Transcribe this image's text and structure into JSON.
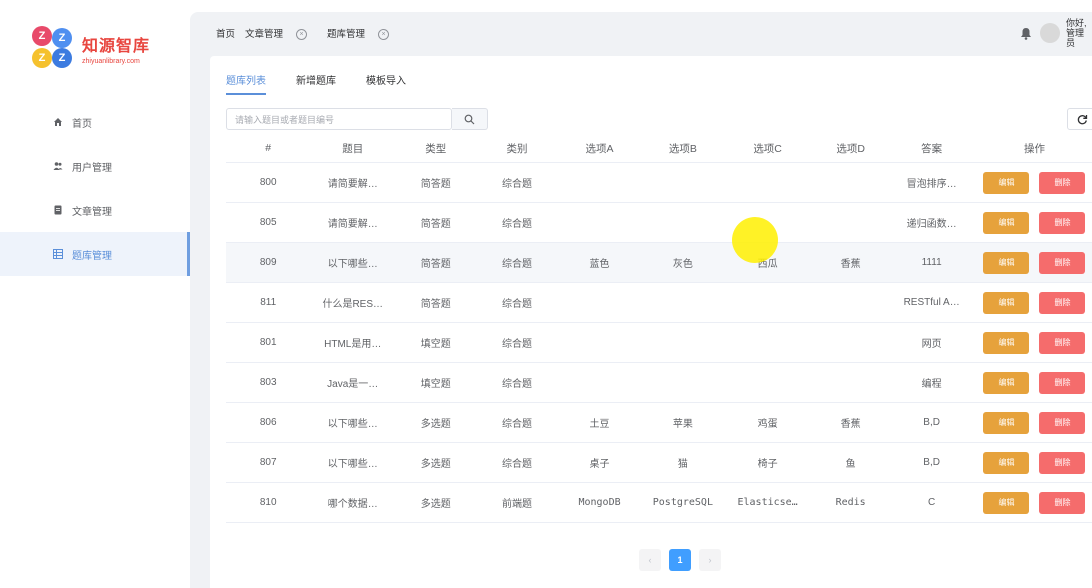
{
  "logo": {
    "title": "知源智库",
    "subtitle": "zhiyuanlibrary.com",
    "badge_letters": [
      "Z",
      "Z",
      "Z",
      "Z"
    ]
  },
  "sidebar": {
    "items": [
      {
        "label": "首页",
        "icon": "home-icon"
      },
      {
        "label": "用户管理",
        "icon": "users-icon"
      },
      {
        "label": "文章管理",
        "icon": "document-icon"
      },
      {
        "label": "题库管理",
        "icon": "table-icon",
        "active": true
      }
    ]
  },
  "breadcrumbs": [
    {
      "label": "首页"
    },
    {
      "label": "文章管理",
      "closable": true
    },
    {
      "label": "题库管理",
      "closable": true
    }
  ],
  "user": {
    "greeting": "你好,管理员"
  },
  "tabs": [
    {
      "label": "题库列表",
      "active": true
    },
    {
      "label": "新增题库"
    },
    {
      "label": "模板导入"
    }
  ],
  "search": {
    "placeholder": "请输入题目或者题目编号"
  },
  "table": {
    "columns": [
      "#",
      "题目",
      "类型",
      "类别",
      "选项A",
      "选项B",
      "选项C",
      "选项D",
      "答案",
      "操作"
    ],
    "edit_label": "编辑",
    "delete_label": "删除",
    "rows": [
      {
        "id": "800",
        "title": "请简要解…",
        "type": "简答题",
        "category": "综合题",
        "a": "",
        "b": "",
        "c": "",
        "d": "",
        "answer": "冒泡排序…"
      },
      {
        "id": "805",
        "title": "请简要解…",
        "type": "简答题",
        "category": "综合题",
        "a": "",
        "b": "",
        "c": "",
        "d": "",
        "answer": "递归函数…"
      },
      {
        "id": "809",
        "title": "以下哪些…",
        "type": "简答题",
        "category": "综合题",
        "a": "蓝色",
        "b": "灰色",
        "c": "西瓜",
        "d": "香蕉",
        "answer": "1111",
        "highlight": true
      },
      {
        "id": "811",
        "title": "什么是RES…",
        "type": "简答题",
        "category": "综合题",
        "a": "",
        "b": "",
        "c": "",
        "d": "",
        "answer": "RESTful A…"
      },
      {
        "id": "801",
        "title": "HTML是用…",
        "type": "填空题",
        "category": "综合题",
        "a": "",
        "b": "",
        "c": "",
        "d": "",
        "answer": "网页"
      },
      {
        "id": "803",
        "title": "Java是一…",
        "type": "填空题",
        "category": "综合题",
        "a": "",
        "b": "",
        "c": "",
        "d": "",
        "answer": "编程"
      },
      {
        "id": "806",
        "title": "以下哪些…",
        "type": "多选题",
        "category": "综合题",
        "a": "土豆",
        "b": "苹果",
        "c": "鸡蛋",
        "d": "香蕉",
        "answer": "B,D"
      },
      {
        "id": "807",
        "title": "以下哪些…",
        "type": "多选题",
        "category": "综合题",
        "a": "桌子",
        "b": "猫",
        "c": "椅子",
        "d": "鱼",
        "answer": "B,D"
      },
      {
        "id": "810",
        "title": "哪个数据…",
        "type": "多选题",
        "category": "前端题",
        "a": "MongoDB",
        "b": "PostgreSQL",
        "c": "Elasticse…",
        "d": "Redis",
        "answer": "C"
      }
    ]
  },
  "pagination": {
    "prev": "‹",
    "current": "1",
    "next": "›"
  },
  "colors": {
    "accent": "#409eff",
    "edit": "#e6a23c",
    "delete": "#f56c6c"
  }
}
